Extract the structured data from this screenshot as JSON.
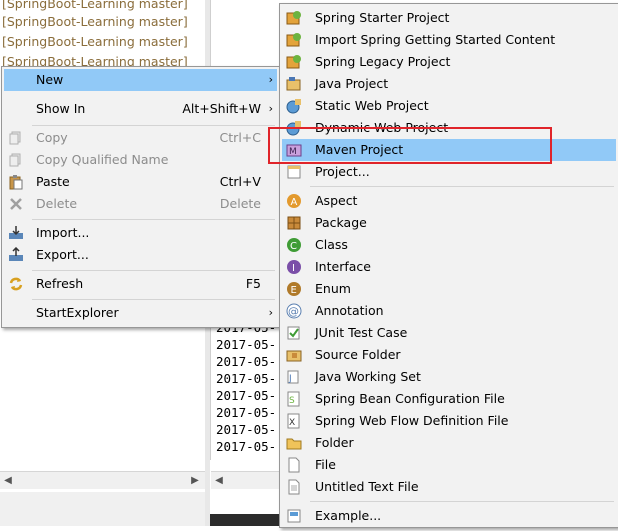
{
  "tree_lines": [
    "[SpringBoot-Learning master]",
    "[SpringBoot-Learning master]",
    "[SpringBoot-Learning master]",
    "[SpringBoot-Learning master]"
  ],
  "log_lines": [
    "2017-05-",
    "2017-05-",
    "2017-05-",
    "2017-05-",
    "2017-05-",
    "2017-05-",
    "2017-05-",
    "2017-05-",
    "2017-05-",
    "2017-05-"
  ],
  "context_menu": {
    "items": [
      {
        "label": "New",
        "accel": "",
        "submenu": true
      },
      {
        "label": "Show In",
        "accel": "Alt+Shift+W",
        "submenu": true
      },
      {
        "label": "Copy",
        "accel": "Ctrl+C",
        "disabled": true
      },
      {
        "label": "Copy Qualified Name",
        "accel": "",
        "disabled": true
      },
      {
        "label": "Paste",
        "accel": "Ctrl+V"
      },
      {
        "label": "Delete",
        "accel": "Delete",
        "disabled": true
      },
      {
        "label": "Import...",
        "accel": ""
      },
      {
        "label": "Export...",
        "accel": ""
      },
      {
        "label": "Refresh",
        "accel": "F5"
      },
      {
        "label": "StartExplorer",
        "accel": "",
        "submenu": true
      }
    ]
  },
  "new_submenu": {
    "items": [
      {
        "label": "Spring Starter Project",
        "icon": "spring-starter-icon"
      },
      {
        "label": "Import Spring Getting Started Content",
        "icon": "spring-import-icon"
      },
      {
        "label": "Spring Legacy Project",
        "icon": "spring-legacy-icon"
      },
      {
        "label": "Java Project",
        "icon": "java-project-icon"
      },
      {
        "label": "Static Web Project",
        "icon": "static-web-icon"
      },
      {
        "label": "Dynamic Web Project",
        "icon": "dynamic-web-icon"
      },
      {
        "label": "Maven Project",
        "icon": "maven-icon"
      },
      {
        "label": "Project...",
        "icon": "project-icon"
      },
      {
        "label": "Aspect",
        "icon": "aspect-icon"
      },
      {
        "label": "Package",
        "icon": "package-icon"
      },
      {
        "label": "Class",
        "icon": "class-icon"
      },
      {
        "label": "Interface",
        "icon": "interface-icon"
      },
      {
        "label": "Enum",
        "icon": "enum-icon"
      },
      {
        "label": "Annotation",
        "icon": "annotation-icon"
      },
      {
        "label": "JUnit Test Case",
        "icon": "junit-icon"
      },
      {
        "label": "Source Folder",
        "icon": "source-folder-icon"
      },
      {
        "label": "Java Working Set",
        "icon": "working-set-icon"
      },
      {
        "label": "Spring Bean Configuration File",
        "icon": "spring-bean-icon"
      },
      {
        "label": "Spring Web Flow Definition File",
        "icon": "web-flow-icon"
      },
      {
        "label": "Folder",
        "icon": "folder-icon"
      },
      {
        "label": "File",
        "icon": "file-icon"
      },
      {
        "label": "Untitled Text File",
        "icon": "text-file-icon"
      },
      {
        "label": "Example...",
        "icon": "example-icon"
      }
    ]
  },
  "colors": {
    "highlight": "#91c9f7",
    "annotation_box": "#e0242a",
    "tree_text": "#8a6d3b"
  }
}
